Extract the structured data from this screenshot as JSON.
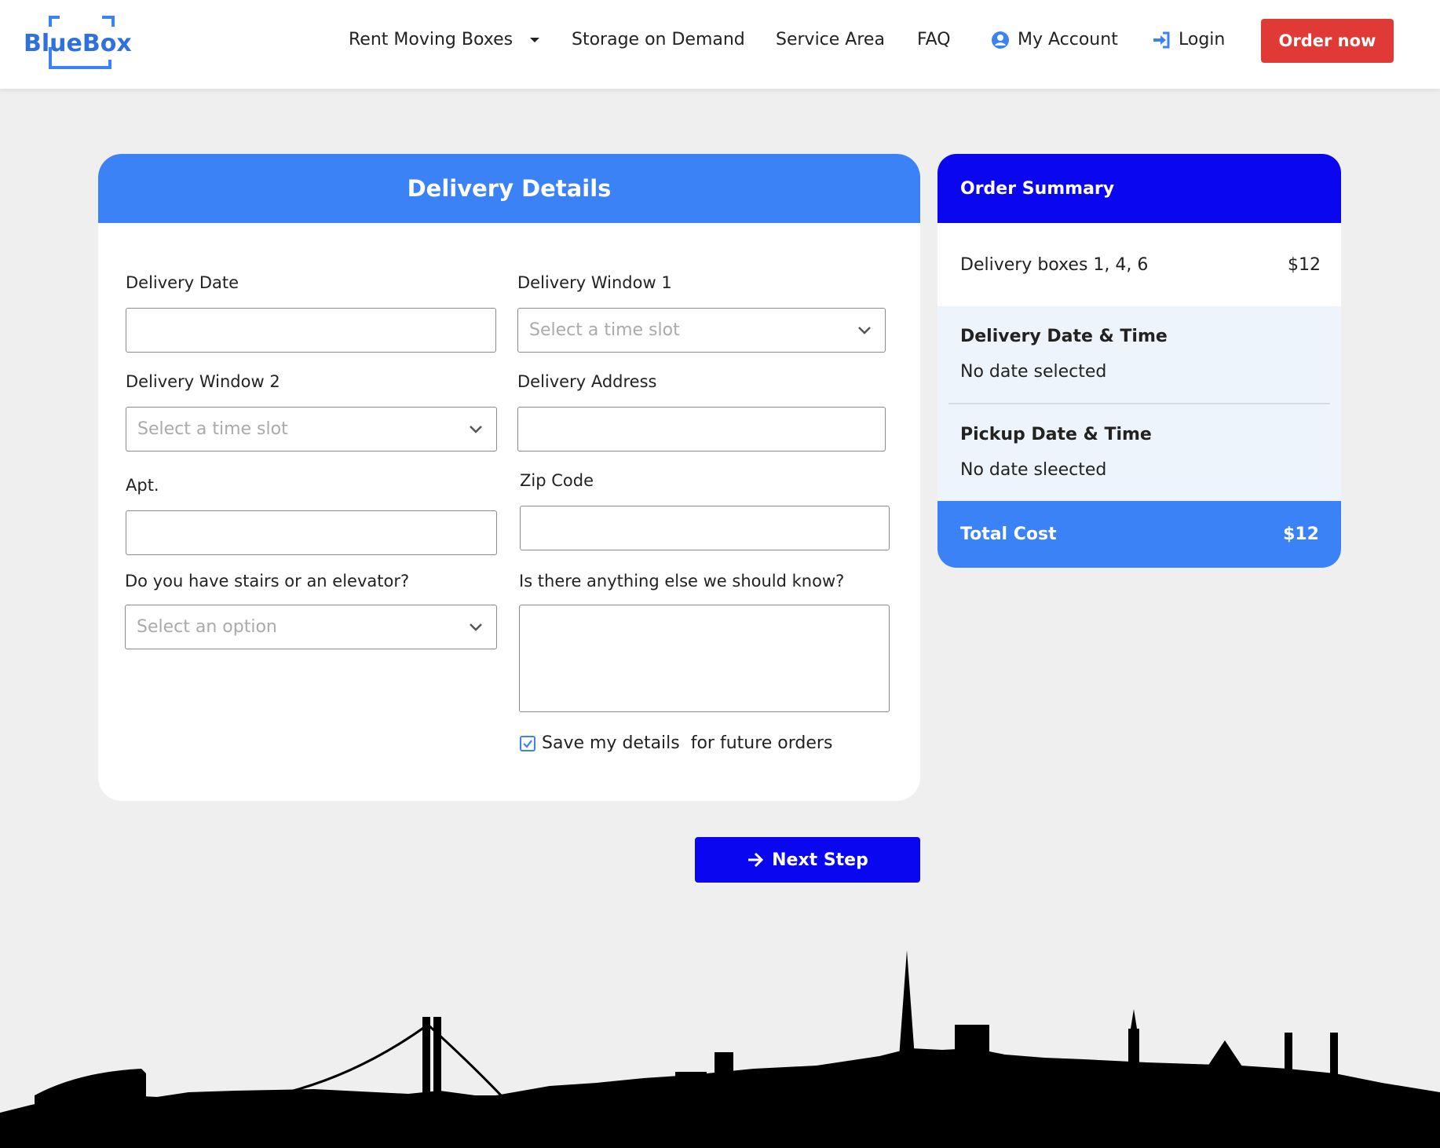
{
  "brand": {
    "logo_text": "BlueBox",
    "accent": "#3b82f6",
    "primary": "#0a06f0",
    "order_red": "#e03a36"
  },
  "nav": {
    "rent_moving_boxes": "Rent Moving Boxes",
    "storage_on_demand": "Storage on Demand",
    "service_area": "Service Area",
    "faq": "FAQ",
    "my_account": "My Account",
    "login": "Login",
    "order_now": "Order now"
  },
  "form": {
    "title": "Delivery Details",
    "delivery_date_label": "Delivery Date",
    "delivery_date_value": "",
    "delivery_window_1_label": "Delivery Window 1",
    "delivery_window_1_placeholder": "Select a time slot",
    "delivery_window_2_label": "Delivery Window 2",
    "delivery_window_2_placeholder": "Select a time slot",
    "delivery_address_label": "Delivery Address",
    "delivery_address_value": "",
    "apt_label": "Apt.",
    "apt_value": "",
    "zip_label": "Zip Code",
    "zip_value": "",
    "stairs_label": "Do you have stairs or an elevator?",
    "stairs_placeholder": "Select an option",
    "notes_label": "Is there anything else we should know?",
    "notes_value": "",
    "save_details_label": "Save my details  for future orders",
    "save_details_checked": true
  },
  "next_step_label": "Next Step",
  "summary": {
    "title": "Order Summary",
    "line_item": "Delivery boxes 1, 4, 6",
    "line_price": "$12",
    "delivery_heading": "Delivery Date & Time",
    "delivery_value": "No date selected",
    "pickup_heading": "Pickup Date & Time",
    "pickup_value": "No date sleected",
    "total_label": "Total Cost",
    "total_value": "$12"
  }
}
